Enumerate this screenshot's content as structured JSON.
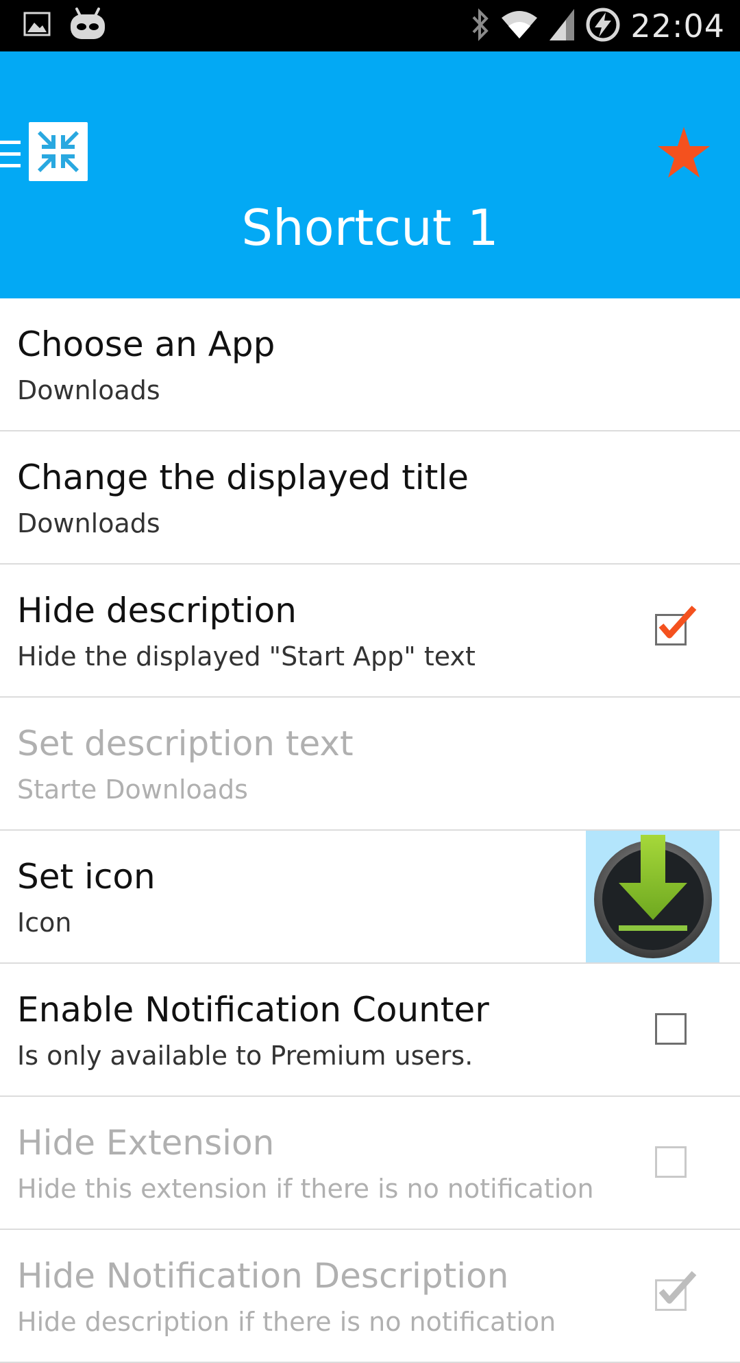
{
  "status_bar": {
    "time": "22:04",
    "icons": [
      "image-icon",
      "android-icon",
      "bluetooth-icon",
      "wifi-icon",
      "signal-icon",
      "battery-charging-icon"
    ]
  },
  "app_bar": {
    "title": "Shortcut 1",
    "icons": [
      "menu-icon",
      "app-logo-icon",
      "star-icon"
    ],
    "colors": {
      "background": "#03a9f4",
      "star": "#f4511e"
    }
  },
  "preferences": [
    {
      "title": "Choose an App",
      "summary": "Downloads",
      "enabled": true,
      "widget": "none"
    },
    {
      "title": "Change the displayed title",
      "summary": "Downloads",
      "enabled": true,
      "widget": "none"
    },
    {
      "title": "Hide description",
      "summary": "Hide the displayed \"Start App\" text",
      "enabled": true,
      "widget": "checkbox",
      "checked": true
    },
    {
      "title": "Set description text",
      "summary": "Starte Downloads",
      "enabled": false,
      "widget": "none"
    },
    {
      "title": "Set icon",
      "summary": "Icon",
      "enabled": true,
      "widget": "icon",
      "icon": "download-icon"
    },
    {
      "title": "Enable Notification Counter",
      "summary": "Is only available to Premium users.",
      "enabled": true,
      "widget": "checkbox",
      "checked": false
    },
    {
      "title": "Hide Extension",
      "summary": "Hide this extension if there is no notification",
      "enabled": false,
      "widget": "checkbox",
      "checked": false
    },
    {
      "title": "Hide Notification Description",
      "summary": "Hide description if there is no notification",
      "enabled": false,
      "widget": "checkbox",
      "checked": true
    }
  ]
}
